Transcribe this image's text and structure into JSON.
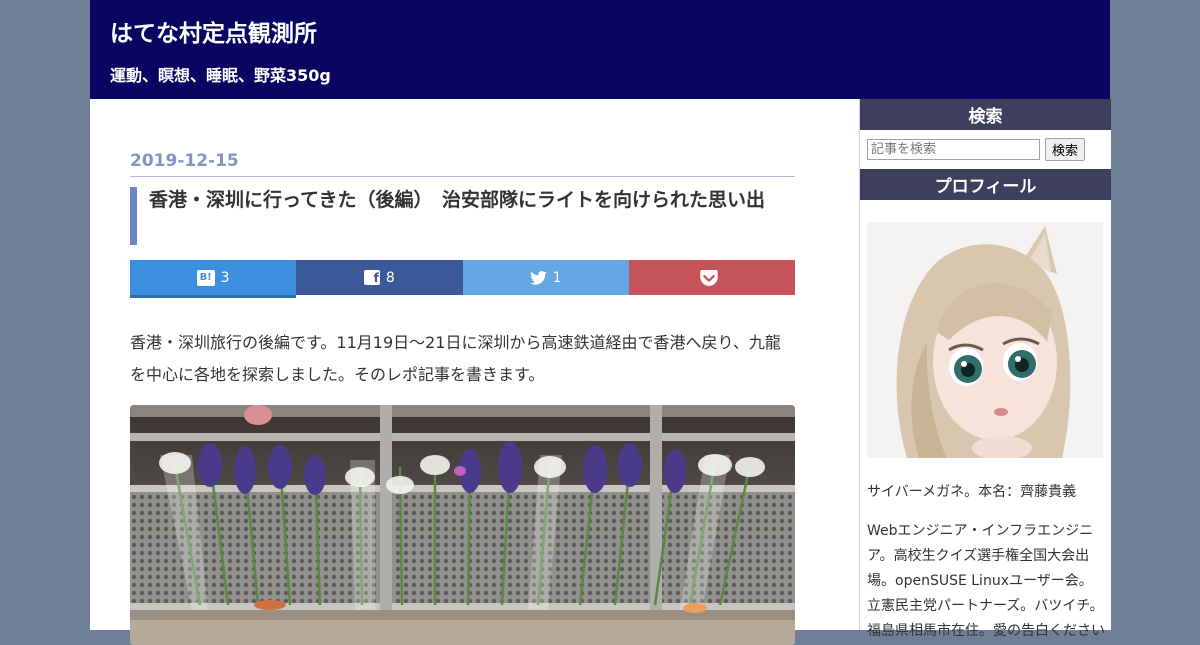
{
  "header": {
    "site_title": "はてな村定点観測所",
    "site_description": "運動、瞑想、睡眠、野菜350g",
    "background_color": "#0a0560"
  },
  "entry": {
    "date": "2019-12-15",
    "title": "香港・深圳に行ってきた（後編）　治安部隊にライトを向けられた思い出",
    "body": "香港・深圳旅行の後編です。11月19日〜21日に深圳から高速鉄道経由で香港へ戻り、九龍を中心に各地を探索しました。そのレポ記事を書きます。",
    "photo_icon": "memorial-flowers-photo"
  },
  "share": {
    "hatena": {
      "icon": "hatena-bookmark-icon",
      "icon_text": "B!",
      "count": "3",
      "color": "#3f8fe0"
    },
    "facebook": {
      "icon": "facebook-icon",
      "icon_text": "f",
      "count": "8",
      "color": "#3b5998"
    },
    "twitter": {
      "icon": "twitter-bird-icon",
      "count": "1",
      "color": "#64a7e2"
    },
    "pocket": {
      "icon": "pocket-icon",
      "color": "#c4545a"
    }
  },
  "sidebar": {
    "search": {
      "title": "検索",
      "placeholder": "記事を検索",
      "button_label": "検索"
    },
    "profile": {
      "title": "プロフィール",
      "avatar_icon": "doll-avatar",
      "name_line": "サイバーメガネ。本名：齊藤貴義",
      "description": "Webエンジニア・インフラエンジニア。高校生クイズ選手権全国大会出場。openSUSE Linuxユーザー会。立憲民主党パートナーズ。バツイチ。福島県相馬市在住。愛の告白ください"
    }
  }
}
